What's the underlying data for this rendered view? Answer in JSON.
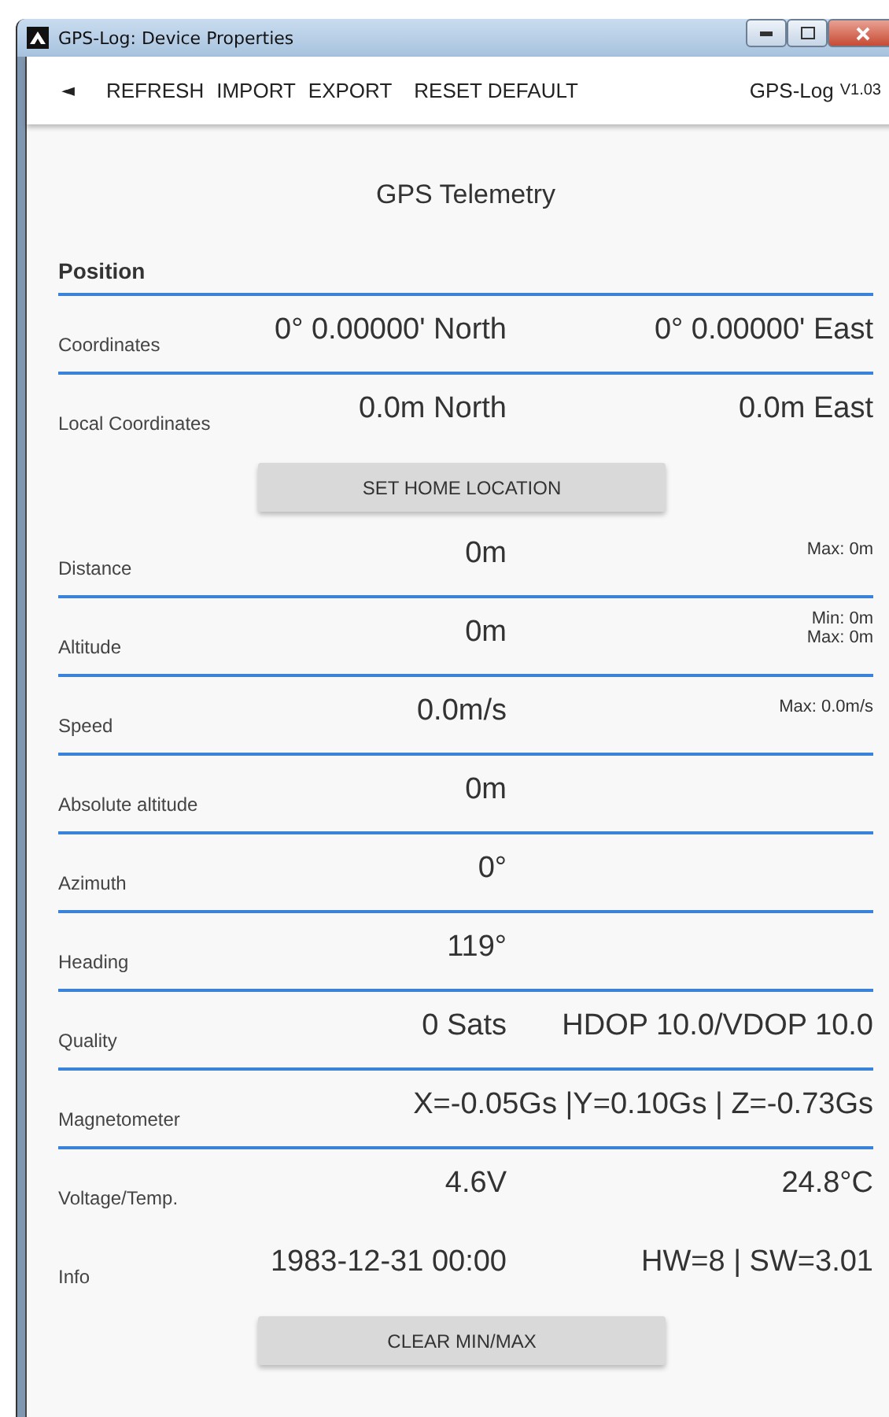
{
  "window": {
    "title": "GPS-Log: Device Properties"
  },
  "toolbar": {
    "back": "◄",
    "actions": [
      "REFRESH",
      "IMPORT",
      "EXPORT",
      "RESET DEFAULT"
    ],
    "app_name": "GPS-Log",
    "version": "V1.03"
  },
  "heading": "GPS Telemetry",
  "section": "Position",
  "rows": [
    {
      "kind": "row",
      "label": "Coordinates",
      "center": "0° 0.00000' North",
      "right": "0° 0.00000' East",
      "divider": true
    },
    {
      "kind": "row",
      "label": "Local Coordinates",
      "center": "0.0m North",
      "right": "0.0m East",
      "divider": false
    },
    {
      "kind": "button",
      "label": "SET HOME LOCATION"
    },
    {
      "kind": "row",
      "label": "Distance",
      "center": "0m",
      "small": [
        "Max: 0m"
      ],
      "divider": true
    },
    {
      "kind": "row",
      "label": "Altitude",
      "center": "0m",
      "small": [
        "Min: 0m",
        "Max: 0m"
      ],
      "divider": true
    },
    {
      "kind": "row",
      "label": "Speed",
      "center": "0.0m/s",
      "small": [
        "Max: 0.0m/s"
      ],
      "divider": true
    },
    {
      "kind": "row",
      "label": "Absolute altitude",
      "center": "0m",
      "divider": true
    },
    {
      "kind": "row",
      "label": "Azimuth",
      "center": "0°",
      "divider": true
    },
    {
      "kind": "row",
      "label": "Heading",
      "center": "119°",
      "divider": true
    },
    {
      "kind": "row",
      "label": "Quality",
      "center": "0 Sats",
      "right": "HDOP 10.0/VDOP 10.0",
      "divider": true
    },
    {
      "kind": "wide",
      "label": "Magnetometer",
      "right": "X=-0.05Gs |Y=0.10Gs | Z=-0.73Gs",
      "divider": true
    },
    {
      "kind": "row",
      "label": "Voltage/Temp.",
      "center": "4.6V",
      "right": "24.8°C",
      "divider": false
    },
    {
      "kind": "row",
      "label": "Info",
      "center": "1983-12-31 00:00",
      "right": "HW=8 | SW=3.01",
      "divider": false
    },
    {
      "kind": "button",
      "label": "CLEAR MIN/MAX"
    }
  ]
}
